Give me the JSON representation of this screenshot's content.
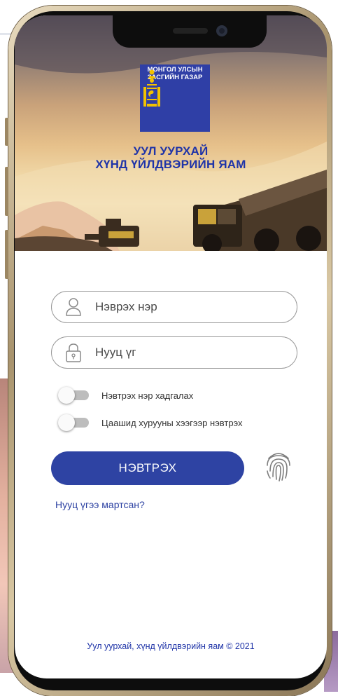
{
  "header": {
    "logo_line1": "МОНГОЛ УЛСЫН",
    "logo_line2": "ЗАСГИЙН ГАЗАР",
    "ministry_line1": "УУЛ УУРХАЙ",
    "ministry_line2": "ХҮНД ҮЙЛДВЭРИЙН ЯАМ"
  },
  "login_form": {
    "username": {
      "icon": "user-icon",
      "placeholder": "Нэврэх нэр",
      "value": ""
    },
    "password": {
      "icon": "lock-icon",
      "placeholder": "Нууц үг",
      "value": ""
    },
    "toggles": [
      {
        "label": "Нэвтрэх нэр хадгалах",
        "checked": false
      },
      {
        "label": "Цаашид хурууны хээгээр нэвтрэх",
        "checked": false
      }
    ],
    "submit_label": "НЭВТРЭХ",
    "fingerprint_icon": "fingerprint-icon",
    "forgot_label": "Нууц үгээ мартсан?"
  },
  "footer": {
    "text": "Уул уурхай,  хүнд үйлдвэрийн яам © 2021"
  },
  "colors": {
    "brand_blue": "#2e43a3",
    "toggle_off": "#bdbdbd",
    "field_border": "#9a9a9a"
  }
}
